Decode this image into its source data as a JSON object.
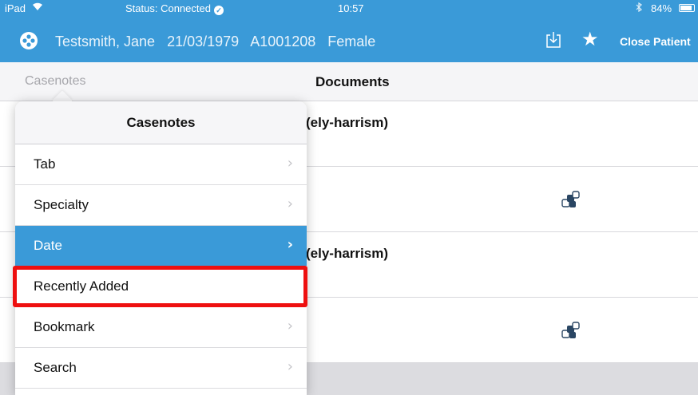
{
  "status_bar": {
    "device": "iPad",
    "connection": "Status: Connected",
    "time": "10:57",
    "battery": "84%"
  },
  "patient": {
    "name": "Testsmith, Jane",
    "dob": "21/03/1979",
    "id": "A1001208",
    "sex": "Female",
    "close_label": "Close Patient"
  },
  "nav": {
    "back_label": "Casenotes",
    "title": "Documents"
  },
  "documents": [
    {
      "name": "(ely-harrism)",
      "icon": ""
    },
    {
      "name": "",
      "icon": "document-type-icon"
    },
    {
      "name": "(ely-harrism)",
      "icon": ""
    },
    {
      "name": "",
      "icon": "document-type-icon"
    }
  ],
  "popover": {
    "title": "Casenotes",
    "items": [
      {
        "label": "Tab",
        "selected": false
      },
      {
        "label": "Specialty",
        "selected": false
      },
      {
        "label": "Date",
        "selected": true
      },
      {
        "label": "Recently Added",
        "selected": false
      },
      {
        "label": "Bookmark",
        "selected": false
      },
      {
        "label": "Search",
        "selected": false
      }
    ]
  },
  "colors": {
    "accent": "#3a9ad8",
    "highlight": "#ee1010"
  }
}
